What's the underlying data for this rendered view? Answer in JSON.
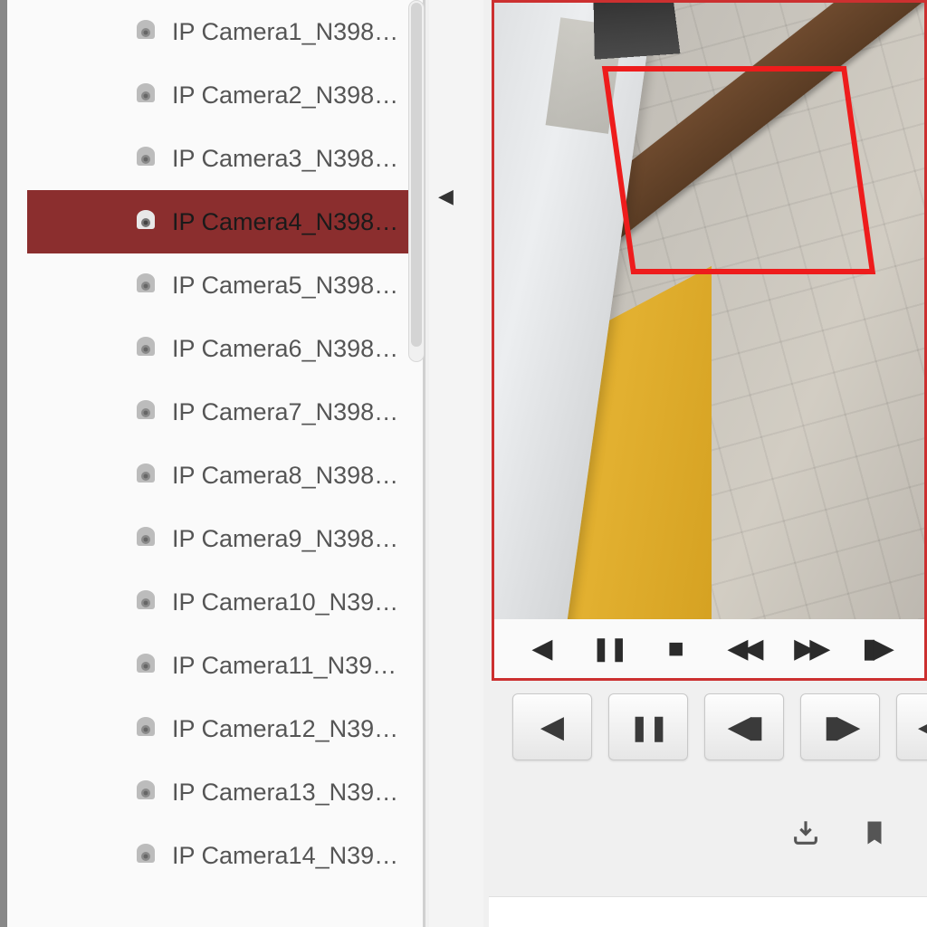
{
  "cameras": [
    {
      "label": "IP Camera1_N398…",
      "selected": false
    },
    {
      "label": "IP Camera2_N398…",
      "selected": false
    },
    {
      "label": "IP Camera3_N398…",
      "selected": false
    },
    {
      "label": "IP Camera4_N398…",
      "selected": true
    },
    {
      "label": "IP Camera5_N398…",
      "selected": false
    },
    {
      "label": "IP Camera6_N398…",
      "selected": false
    },
    {
      "label": "IP Camera7_N398…",
      "selected": false
    },
    {
      "label": "IP Camera8_N398…",
      "selected": false
    },
    {
      "label": "IP Camera9_N398…",
      "selected": false
    },
    {
      "label": "IP Camera10_N39…",
      "selected": false
    },
    {
      "label": "IP Camera11_N39…",
      "selected": false
    },
    {
      "label": "IP Camera12_N39…",
      "selected": false
    },
    {
      "label": "IP Camera13_N39…",
      "selected": false
    },
    {
      "label": "IP Camera14_N39…",
      "selected": false
    }
  ],
  "inner_controls": {
    "prev": "◀",
    "pause": "❚❚",
    "stop": "■",
    "rewind": "◀◀",
    "forward": "▶▶",
    "step_fwd": "▮▶"
  },
  "outer_controls": {
    "prev": "◀",
    "pause": "❚❚",
    "step_back": "◀▮",
    "step_fwd": "▮▶",
    "rewind": "◀◀"
  },
  "bottom_icons": {
    "download": "download-icon",
    "bookmark": "bookmark-icon"
  },
  "colors": {
    "selected_bg": "#8b2e2e",
    "video_border": "#cc3030",
    "roi_box": "#ee1c1c"
  }
}
